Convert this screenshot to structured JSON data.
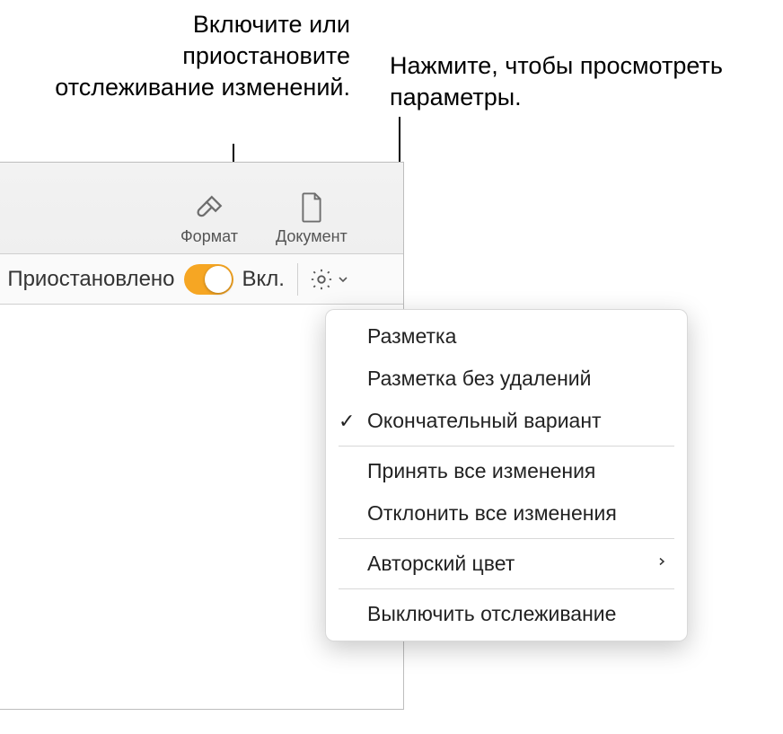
{
  "callouts": {
    "left": "Включите или приостановите отслеживание изменений.",
    "right": "Нажмите, чтобы просмотреть параметры."
  },
  "toolbar": {
    "format_label": "Формат",
    "document_label": "Документ"
  },
  "status_bar": {
    "left_text": ": Приостановлено",
    "on_label": "Вкл."
  },
  "gear_icon_name": "gear-icon",
  "popup": {
    "items": [
      {
        "label": "Разметка",
        "checked": false,
        "submenu": false
      },
      {
        "label": "Разметка без удалений",
        "checked": false,
        "submenu": false
      },
      {
        "label": "Окончательный вариант",
        "checked": true,
        "submenu": false
      }
    ],
    "group2": [
      {
        "label": "Принять все изменения",
        "checked": false,
        "submenu": false
      },
      {
        "label": "Отклонить все изменения",
        "checked": false,
        "submenu": false
      }
    ],
    "group3": [
      {
        "label": "Авторский цвет",
        "checked": false,
        "submenu": true
      }
    ],
    "group4": [
      {
        "label": "Выключить отслеживание",
        "checked": false,
        "submenu": false
      }
    ]
  }
}
